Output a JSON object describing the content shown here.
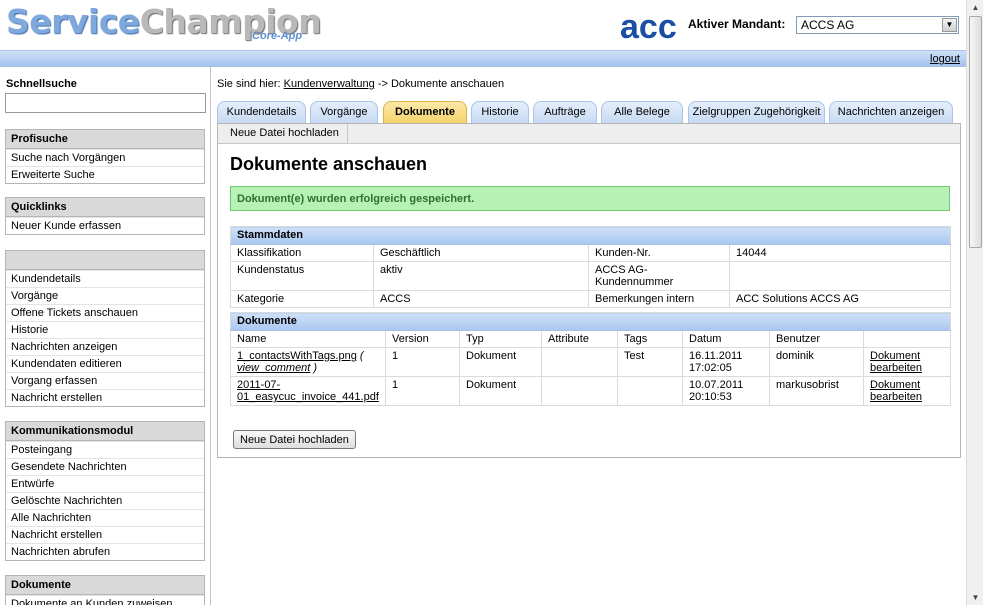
{
  "header": {
    "logo_part1": "Service",
    "logo_part2": "Champion",
    "logo_sub": "Core-App",
    "acc_logo": "acc",
    "mandant_label": "Aktiver Mandant:",
    "mandant_value": "ACCS AG",
    "logout": "logout"
  },
  "sidebar": {
    "schnellsuche_label": "Schnellsuche",
    "schnellsuche_value": "",
    "panels": [
      {
        "title": "Profisuche",
        "items": [
          "Suche nach Vorgängen",
          "Erweiterte Suche"
        ]
      },
      {
        "title": "Quicklinks",
        "items": [
          "Neuer Kunde erfassen"
        ]
      },
      {
        "title": "",
        "items": [
          "Kundendetails",
          "Vorgänge",
          "Offene Tickets anschauen",
          "Historie",
          "Nachrichten anzeigen",
          "Kundendaten editieren",
          "Vorgang erfassen",
          "Nachricht erstellen"
        ]
      },
      {
        "title": "Kommunikationsmodul",
        "items": [
          "Posteingang",
          "Gesendete Nachrichten",
          "Entwürfe",
          "Gelöschte Nachrichten",
          "Alle Nachrichten",
          "Nachricht erstellen",
          "Nachrichten abrufen"
        ]
      },
      {
        "title": "Dokumente",
        "items": [
          "Dokumente an Kunden zuweisen"
        ]
      }
    ]
  },
  "breadcrumb": {
    "prefix": "Sie sind hier:",
    "link": "Kundenverwaltung",
    "rest": "-> Dokumente anschauen"
  },
  "tabs": [
    "Kundendetails",
    "Vorgänge",
    "Dokumente",
    "Historie",
    "Aufträge",
    "Alle Belege",
    "Zielgruppen Zugehörigkeit",
    "Nachrichten anzeigen"
  ],
  "subtab": "Neue Datei hochladen",
  "page_title": "Dokumente anschauen",
  "success_message": "Dokument(e) wurden erfolgreich gespeichert.",
  "stammdaten": {
    "title": "Stammdaten",
    "rows": [
      [
        "Klassifikation",
        "Geschäftlich",
        "Kunden-Nr.",
        "14044"
      ],
      [
        "Kundenstatus",
        "aktiv",
        "ACCS AG-Kundennummer",
        ""
      ],
      [
        "Kategorie",
        "ACCS",
        "Bemerkungen intern",
        "ACC Solutions ACCS AG"
      ]
    ]
  },
  "dokumente": {
    "title": "Dokumente",
    "columns": [
      "Name",
      "Version",
      "Typ",
      "Attribute",
      "Tags",
      "Datum",
      "Benutzer",
      ""
    ],
    "rows": [
      {
        "name": "1_contactsWithTags.png",
        "comment": "view_comment",
        "version": "1",
        "typ": "Dokument",
        "attribute": "",
        "tags": "Test",
        "datum": "16.11.2011",
        "zeit": "17:02:05",
        "benutzer": "dominik",
        "action1": "Dokument",
        "action2": "bearbeiten"
      },
      {
        "name_line1": "2011-07-",
        "name_line2": "01_easycuc_invoice_441.pdf",
        "version": "1",
        "typ": "Dokument",
        "attribute": "",
        "tags": "",
        "datum": "10.07.2011",
        "zeit": "20:10:53",
        "benutzer": "markusobrist",
        "action1": "Dokument",
        "action2": "bearbeiten"
      }
    ]
  },
  "upload_button": "Neue Datei hochladen"
}
